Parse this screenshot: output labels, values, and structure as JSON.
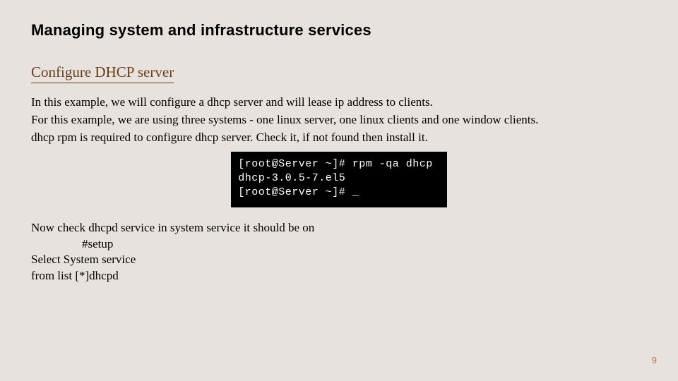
{
  "title": "Managing system and infrastructure services",
  "subtitle": "Configure DHCP server",
  "intro": {
    "l1": "In this example, we will configure a dhcp server and will lease ip address to clients.",
    "l2": "For this example, we are using three systems - one linux server, one linux clients and one window clients.",
    "l3": "dhcp rpm is required to configure dhcp server. Check it, if not found then install it."
  },
  "terminal": {
    "l1": "[root@Server ~]# rpm -qa dhcp",
    "l2": "dhcp-3.0.5-7.el5",
    "l3": "[root@Server ~]# _"
  },
  "footer": {
    "l1": "Now check dhcpd service in system service it should be on",
    "l2": "#setup",
    "l3": "Select  System service",
    "l4": "from list [*]dhcpd"
  },
  "page_number": "9"
}
